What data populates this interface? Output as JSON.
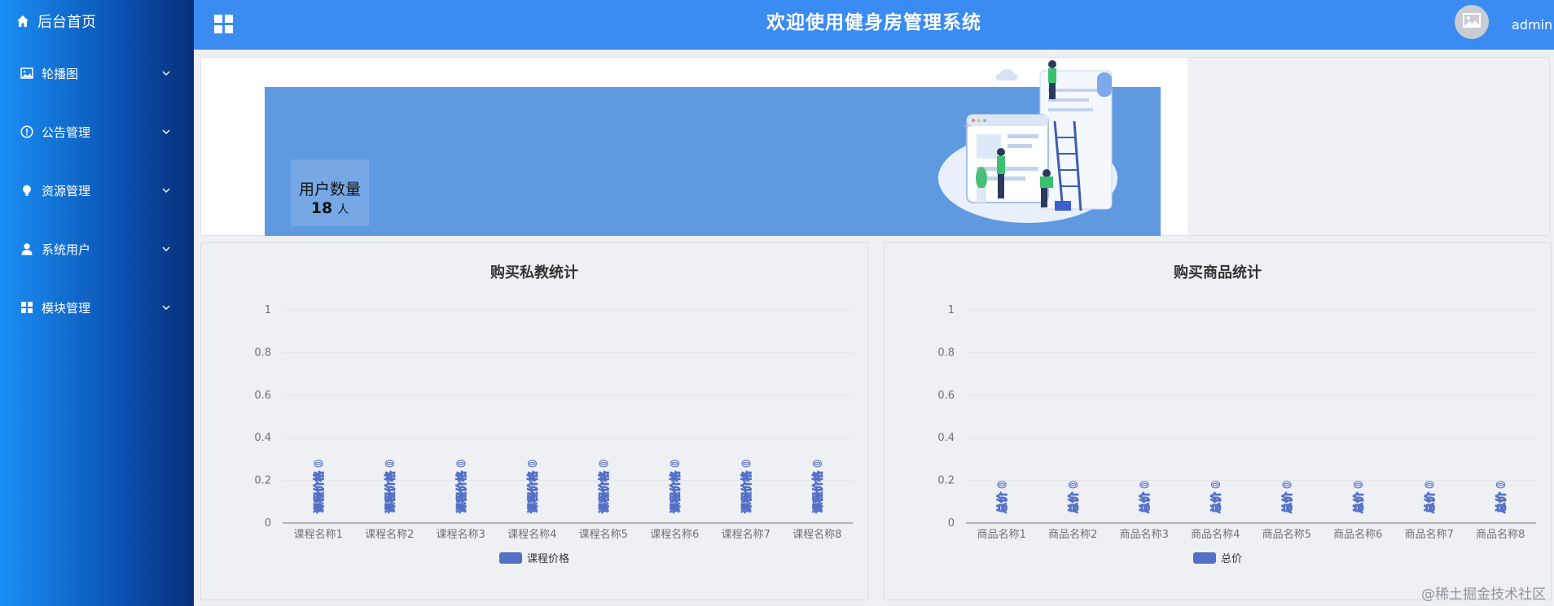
{
  "sidebar": {
    "home_label": "后台首页",
    "items": [
      {
        "label": "轮播图",
        "icon": "image-icon"
      },
      {
        "label": "公告管理",
        "icon": "info-icon"
      },
      {
        "label": "资源管理",
        "icon": "bulb-icon"
      },
      {
        "label": "系统用户",
        "icon": "user-icon"
      },
      {
        "label": "模块管理",
        "icon": "grid-icon"
      }
    ]
  },
  "header": {
    "title": "欢迎使用健身房管理系统",
    "username": "admin"
  },
  "banner": {
    "user_count_label": "用户数量",
    "user_count_value": "18",
    "user_count_unit": "人"
  },
  "colors": {
    "sidebar_top": "#1a8ff5",
    "header_bg": "#3a8bf2",
    "bar_series": "#5470c6"
  },
  "chart_data": [
    {
      "type": "bar",
      "title": "购买私教统计",
      "categories": [
        "课程名称1",
        "课程名称2",
        "课程名称3",
        "课程名称4",
        "课程名称5",
        "课程名称6",
        "课程名称7",
        "课程名称8"
      ],
      "series": [
        {
          "name": "课程价格",
          "values": [
            0,
            0,
            0,
            0,
            0,
            0,
            0,
            0
          ]
        }
      ],
      "data_label_prefix": "课程价格",
      "yticks": [
        "0",
        "0.2",
        "0.4",
        "0.6",
        "0.8",
        "1"
      ],
      "ylim": [
        0,
        1
      ],
      "grid": true,
      "legend": "bottom-center"
    },
    {
      "type": "bar",
      "title": "购买商品统计",
      "categories": [
        "商品名称1",
        "商品名称2",
        "商品名称3",
        "商品名称4",
        "商品名称5",
        "商品名称6",
        "商品名称7",
        "商品名称8"
      ],
      "series": [
        {
          "name": "总价",
          "values": [
            0,
            0,
            0,
            0,
            0,
            0,
            0,
            0
          ]
        }
      ],
      "data_label_prefix": "总价",
      "yticks": [
        "0",
        "0.2",
        "0.4",
        "0.6",
        "0.8",
        "1"
      ],
      "ylim": [
        0,
        1
      ],
      "grid": true,
      "legend": "bottom-center"
    }
  ],
  "watermark": "@稀土掘金技术社区"
}
